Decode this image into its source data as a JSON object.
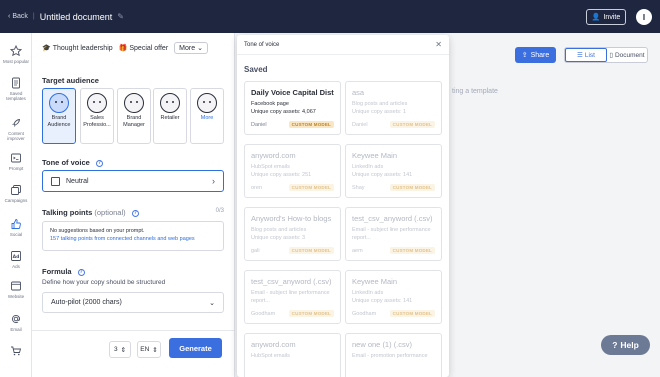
{
  "topbar": {
    "back_label": "Back",
    "doc_title": "Untitled document",
    "invite_label": "Invite",
    "avatar_initial": "I"
  },
  "rail": {
    "items": [
      {
        "label": "Most popular",
        "icon": "star-icon"
      },
      {
        "label": "Saved templates",
        "icon": "document-icon"
      },
      {
        "label": "Content improver",
        "icon": "rocket-icon"
      },
      {
        "label": "Prompt",
        "icon": "terminal-icon"
      },
      {
        "label": "Campaigns",
        "icon": "copy-icon"
      },
      {
        "label": "Social",
        "icon": "thumbs-up-icon"
      },
      {
        "label": "Ads",
        "icon": "ad-icon"
      },
      {
        "label": "Website",
        "icon": "browser-icon"
      },
      {
        "label": "Email",
        "icon": "at-icon"
      },
      {
        "label": "",
        "icon": "cart-icon"
      }
    ]
  },
  "panel": {
    "chips": [
      "Thought leadership",
      "Special offer",
      "More"
    ],
    "target_audience_label": "Target audience",
    "audiences": [
      "Brand Audience",
      "Sales Professio...",
      "Brand Manager",
      "Retailer",
      "More"
    ],
    "tone_label": "Tone of voice",
    "tone_value": "Neutral",
    "talking_label": "Talking points",
    "talking_optional": "(optional)",
    "talking_count": "0/3",
    "talking_line1": "No suggestions based on your prompt.",
    "talking_line2": "157 talking points from connected channels and web pages",
    "formula_label": "Formula",
    "formula_sub": "Define how your copy should be structured",
    "formula_value": "Auto-pilot (2000 chars)",
    "count_value": "3",
    "lang_value": "EN",
    "generate_label": "Generate"
  },
  "editor": {
    "share_label": "Share",
    "list_label": "List",
    "document_label": "Document",
    "hint": "ting a template",
    "help_label": "Help"
  },
  "modal": {
    "title": "Tone of voice",
    "saved_label": "Saved",
    "cards": [
      {
        "title": "Daily Voice Capital District",
        "line1": "Facebook page",
        "line2": "Unique copy assets: 4,067",
        "owner": "Daniel",
        "badge": "CUSTOM MODEL",
        "active": true
      },
      {
        "title": "asa",
        "line1": "Blog posts and articles",
        "line2": "Unique copy assets: 1",
        "owner": "Daniel",
        "badge": "CUSTOM MODEL",
        "active": false
      },
      {
        "title": "anyword.com",
        "line1": "HubSpot emails",
        "line2": "Unique copy assets: 251",
        "owner": "oren",
        "badge": "CUSTOM MODEL",
        "active": false
      },
      {
        "title": "Keywee Main",
        "line1": "LinkedIn ads",
        "line2": "Unique copy assets: 141",
        "owner": "Shay",
        "badge": "CUSTOM MODEL",
        "active": false
      },
      {
        "title": "Anyword's How-to blogs",
        "line1": "Blog posts and articles",
        "line2": "Unique copy assets: 3",
        "owner": "gali",
        "badge": "CUSTOM MODEL",
        "active": false
      },
      {
        "title": "test_csv_anyword (.csv)",
        "line1": "Email - subject line performance",
        "line2": "report...",
        "owner": "aem",
        "badge": "CUSTOM MODEL",
        "active": false
      },
      {
        "title": "test_csv_anyword (.csv)",
        "line1": "Email - subject line performance",
        "line2": "report...",
        "owner": "Goodham",
        "badge": "CUSTOM MODEL",
        "active": false
      },
      {
        "title": "Keywee Main",
        "line1": "LinkedIn ads",
        "line2": "Unique copy assets: 141",
        "owner": "Goodham",
        "badge": "CUSTOM MODEL",
        "active": false
      },
      {
        "title": "anyword.com",
        "line1": "HubSpot emails",
        "line2": "",
        "owner": "",
        "badge": "",
        "active": false
      },
      {
        "title": "new one (1) (.csv)",
        "line1": "Email - promotion performance",
        "line2": "",
        "owner": "",
        "badge": "",
        "active": false
      }
    ]
  }
}
